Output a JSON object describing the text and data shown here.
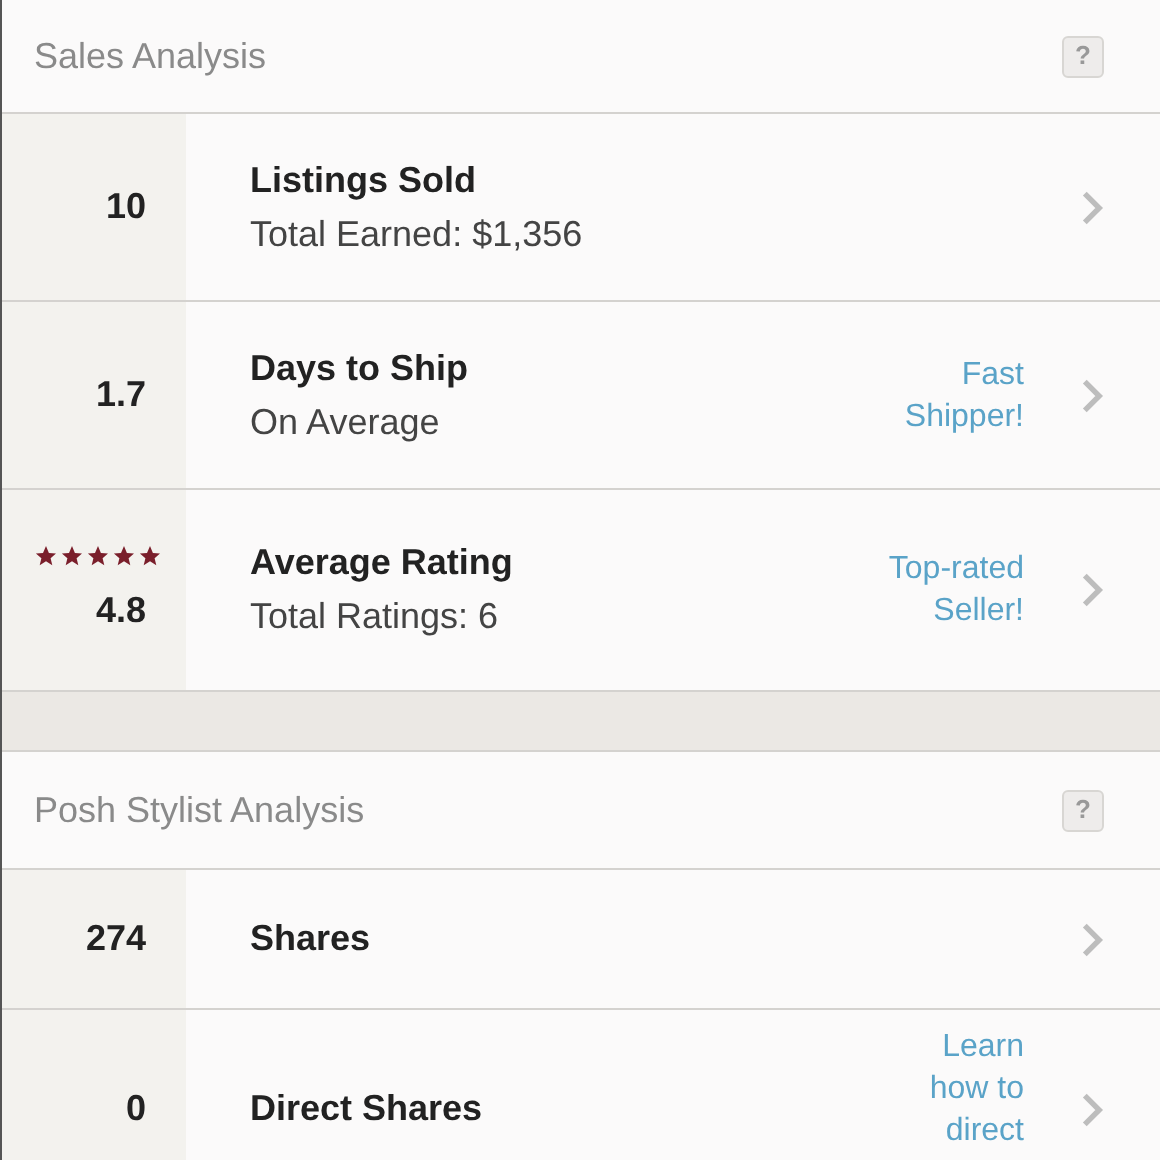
{
  "sections": [
    {
      "title": "Sales Analysis",
      "help": "?",
      "rows": [
        {
          "value": "10",
          "title": "Listings Sold",
          "subtitle": "Total Earned: $1,356"
        },
        {
          "value": "1.7",
          "title": "Days to Ship",
          "subtitle": "On Average",
          "link": "Fast Shipper!"
        },
        {
          "value": "4.8",
          "stars": 5,
          "title": "Average Rating",
          "subtitle": "Total Ratings: 6",
          "link": "Top-rated Seller!"
        }
      ]
    },
    {
      "title": "Posh Stylist Analysis",
      "help": "?",
      "rows": [
        {
          "value": "274",
          "title": "Shares"
        },
        {
          "value": "0",
          "title": "Direct Shares",
          "link": "Learn how to direct"
        }
      ]
    }
  ]
}
